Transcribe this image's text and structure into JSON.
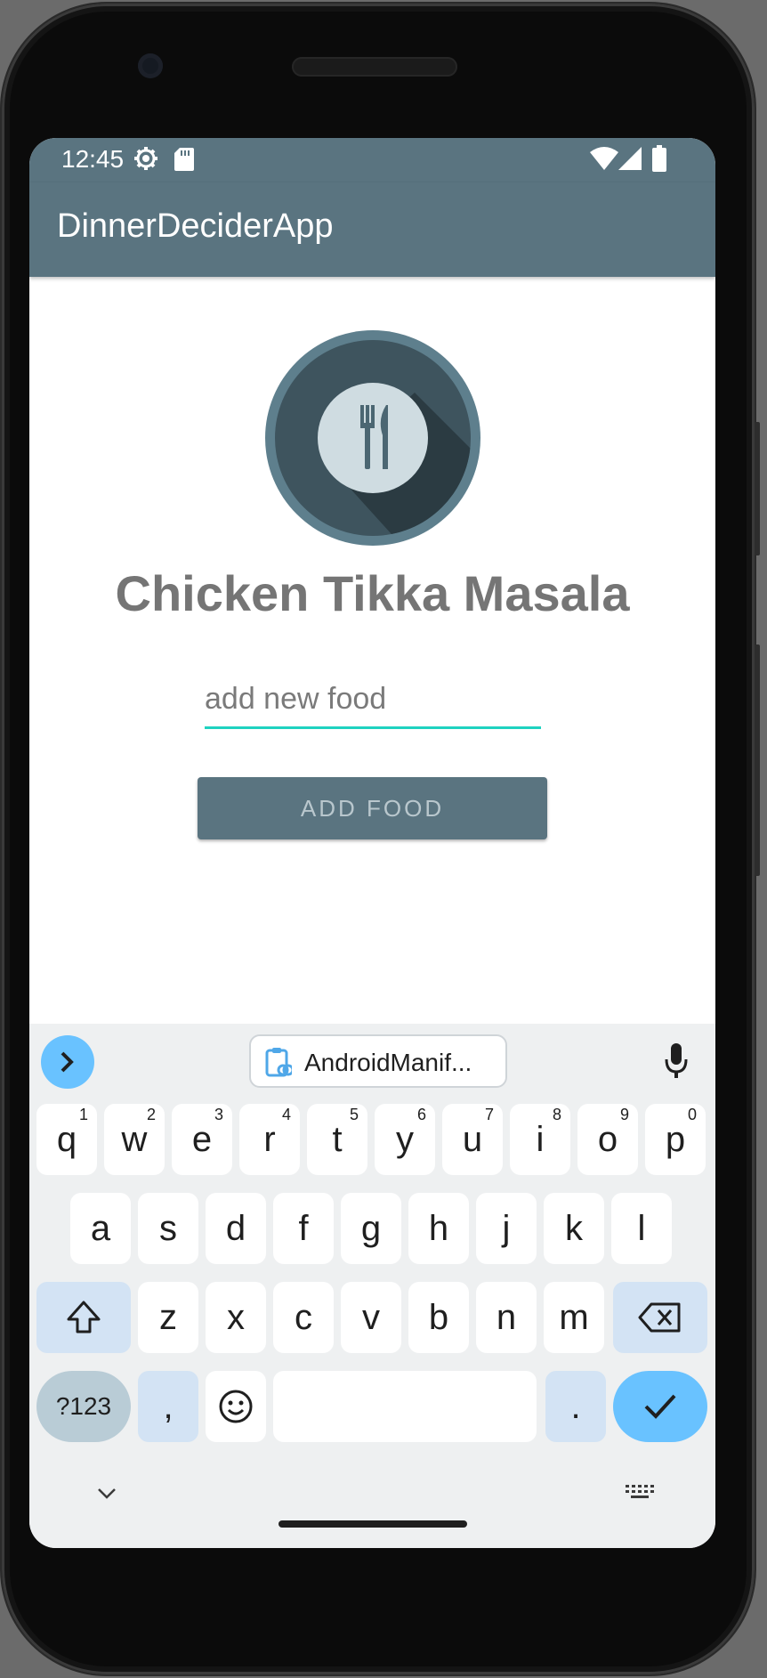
{
  "status_bar": {
    "time": "12:45"
  },
  "app_bar": {
    "title": "DinnerDeciderApp"
  },
  "main": {
    "food_name": "Chicken Tikka Masala",
    "input_placeholder": "add new food",
    "add_button_label": "ADD FOOD"
  },
  "colors": {
    "primary": "#5a7480",
    "accent": "#1fd2c0",
    "food_text": "#757575"
  },
  "keyboard": {
    "clipboard_suggestion": "AndroidManif...",
    "row1": [
      {
        "key": "q",
        "hint": "1"
      },
      {
        "key": "w",
        "hint": "2"
      },
      {
        "key": "e",
        "hint": "3"
      },
      {
        "key": "r",
        "hint": "4"
      },
      {
        "key": "t",
        "hint": "5"
      },
      {
        "key": "y",
        "hint": "6"
      },
      {
        "key": "u",
        "hint": "7"
      },
      {
        "key": "i",
        "hint": "8"
      },
      {
        "key": "o",
        "hint": "9"
      },
      {
        "key": "p",
        "hint": "0"
      }
    ],
    "row2": [
      "a",
      "s",
      "d",
      "f",
      "g",
      "h",
      "j",
      "k",
      "l"
    ],
    "row3": [
      "z",
      "x",
      "c",
      "v",
      "b",
      "n",
      "m"
    ],
    "symbols_label": "?123",
    "comma_label": ",",
    "period_label": "."
  }
}
